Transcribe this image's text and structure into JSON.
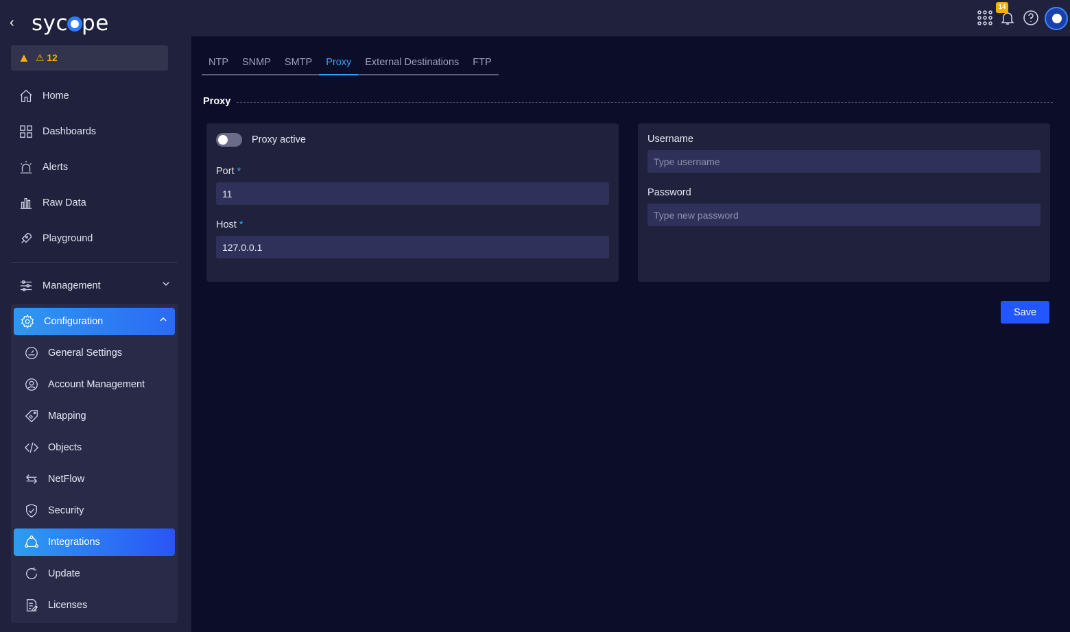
{
  "app": {
    "logo_text_a": "syc",
    "logo_text_b": "pe",
    "back_label": "‹"
  },
  "alert": {
    "icon": "warning-icon",
    "count_label": "⚠ 12"
  },
  "nav": {
    "home": "Home",
    "dashboards": "Dashboards",
    "alerts": "Alerts",
    "raw_data": "Raw Data",
    "playground": "Playground",
    "management": "Management",
    "configuration": "Configuration"
  },
  "config_items": {
    "general": "General Settings",
    "account": "Account Management",
    "mapping": "Mapping",
    "objects": "Objects",
    "netflow": "NetFlow",
    "security": "Security",
    "integrations": "Integrations",
    "update": "Update",
    "licenses": "Licenses"
  },
  "topbar": {
    "notification_count": "14"
  },
  "tabs": {
    "ntp": "NTP",
    "snmp": "SNMP",
    "smtp": "SMTP",
    "proxy": "Proxy",
    "external": "External Destinations",
    "ftp": "FTP"
  },
  "section": {
    "title": "Proxy"
  },
  "form": {
    "proxy_active_label": "Proxy active",
    "port_label": "Port",
    "port_value": "11",
    "host_label": "Host",
    "host_value": "127.0.0.1",
    "required_mark": "*",
    "username_label": "Username",
    "username_placeholder": "Type username",
    "password_label": "Password",
    "password_placeholder": "Type new password",
    "save_label": "Save"
  },
  "colors": {
    "accent": "#2ea6ff",
    "primary_button": "#2356ff",
    "warning": "#f6b100",
    "sidebar_bg": "#20213c",
    "page_bg": "#0c0d29"
  }
}
